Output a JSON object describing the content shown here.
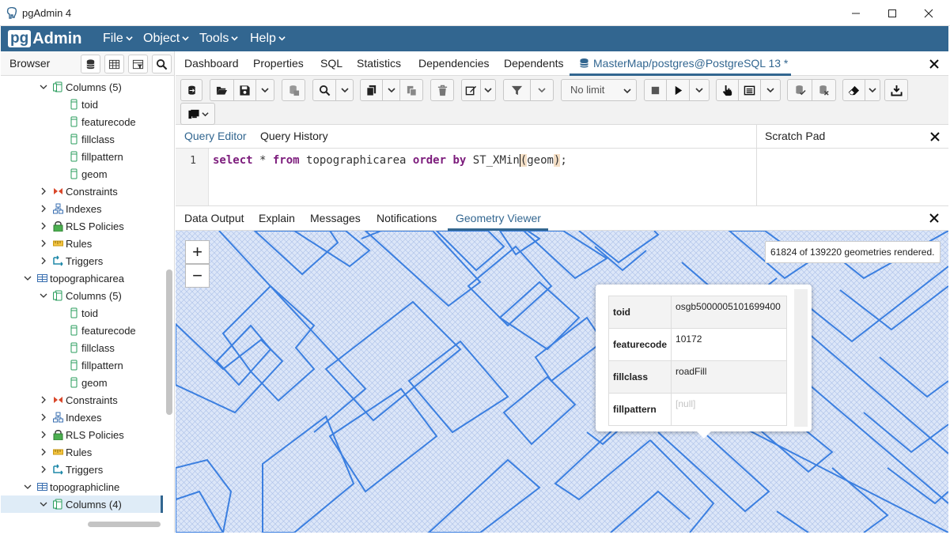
{
  "window": {
    "title": "pgAdmin 4"
  },
  "menubar": {
    "logo_pg": "pg",
    "logo_admin": "Admin",
    "items": [
      {
        "label": "File"
      },
      {
        "label": "Object"
      },
      {
        "label": "Tools"
      },
      {
        "label": "Help"
      }
    ]
  },
  "browser": {
    "title": "Browser",
    "tree": [
      {
        "label": "Columns (5)",
        "icon": "columns-icon",
        "expanded": true
      },
      {
        "label": "toid",
        "icon": "column-icon"
      },
      {
        "label": "featurecode",
        "icon": "column-icon"
      },
      {
        "label": "fillclass",
        "icon": "column-icon"
      },
      {
        "label": "fillpattern",
        "icon": "column-icon"
      },
      {
        "label": "geom",
        "icon": "column-icon"
      },
      {
        "label": "Constraints",
        "icon": "constraints-icon"
      },
      {
        "label": "Indexes",
        "icon": "indexes-icon"
      },
      {
        "label": "RLS Policies",
        "icon": "rls-policies-icon"
      },
      {
        "label": "Rules",
        "icon": "rules-icon"
      },
      {
        "label": "Triggers",
        "icon": "triggers-icon"
      },
      {
        "label": "topographicarea",
        "icon": "table-icon",
        "expanded": true
      },
      {
        "label": "Columns (5)",
        "icon": "columns-icon",
        "expanded": true
      },
      {
        "label": "toid",
        "icon": "column-icon"
      },
      {
        "label": "featurecode",
        "icon": "column-icon"
      },
      {
        "label": "fillclass",
        "icon": "column-icon"
      },
      {
        "label": "fillpattern",
        "icon": "column-icon"
      },
      {
        "label": "geom",
        "icon": "column-icon"
      },
      {
        "label": "Constraints",
        "icon": "constraints-icon"
      },
      {
        "label": "Indexes",
        "icon": "indexes-icon"
      },
      {
        "label": "RLS Policies",
        "icon": "rls-policies-icon"
      },
      {
        "label": "Rules",
        "icon": "rules-icon"
      },
      {
        "label": "Triggers",
        "icon": "triggers-icon"
      },
      {
        "label": "topographicline",
        "icon": "table-icon",
        "expanded": true
      },
      {
        "label": "Columns (4)",
        "icon": "columns-icon",
        "expanded": true,
        "selected": true
      }
    ]
  },
  "tabs": [
    {
      "label": "Dashboard"
    },
    {
      "label": "Properties"
    },
    {
      "label": "SQL"
    },
    {
      "label": "Statistics"
    },
    {
      "label": "Dependencies"
    },
    {
      "label": "Dependents"
    },
    {
      "label": "MasterMap/postgres@PostgreSQL 13 *",
      "active": true
    }
  ],
  "toolbar": {
    "row_limit": "No limit"
  },
  "editor": {
    "tabs": [
      {
        "label": "Query Editor",
        "active": true
      },
      {
        "label": "Query History"
      }
    ],
    "line_number": "1",
    "tokens": {
      "select": "select",
      "star": " * ",
      "from": "from",
      "table": " topographicarea ",
      "order": "order",
      "sp": " ",
      "by": "by",
      "func": " ST_XMin",
      "lparen": "(",
      "arg": "geom",
      "rparen": ")",
      "semi": ";"
    }
  },
  "scratch_pad": {
    "title": "Scratch Pad"
  },
  "output": {
    "tabs": [
      {
        "label": "Data Output"
      },
      {
        "label": "Explain"
      },
      {
        "label": "Messages"
      },
      {
        "label": "Notifications"
      },
      {
        "label": "Geometry Viewer",
        "active": true
      }
    ],
    "zoom_in": "+",
    "zoom_out": "−",
    "rendered_info": "61824 of 139220 geometries rendered.",
    "popup": {
      "rows": [
        {
          "key": "toid",
          "value": "osgb5000005101699400"
        },
        {
          "key": "featurecode",
          "value": "10172"
        },
        {
          "key": "fillclass",
          "value": "roadFill"
        },
        {
          "key": "fillpattern",
          "value": "[null]"
        }
      ]
    }
  },
  "colors": {
    "brand": "#326690",
    "map_stroke": "#3b7fe0",
    "map_fill": "#d6e2f7",
    "sql_keyword": "#7c1c7c"
  }
}
